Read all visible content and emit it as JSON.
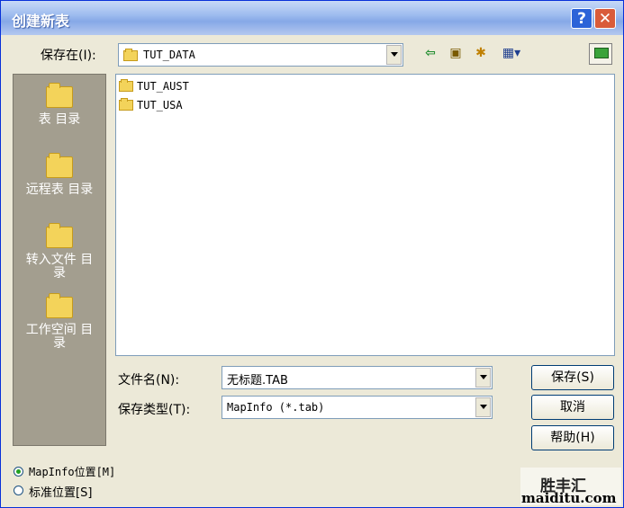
{
  "window": {
    "title": "创建新表"
  },
  "title_buttons": {
    "help": "?",
    "close": "✕"
  },
  "save_in": {
    "label": "保存在(I):",
    "value": "TUT_DATA"
  },
  "toolbar": [
    {
      "name": "back-arrow-icon",
      "glyph": "⇦"
    },
    {
      "name": "up-folder-icon",
      "glyph": "▣"
    },
    {
      "name": "new-folder-icon",
      "glyph": "✱"
    },
    {
      "name": "view-menu-icon",
      "glyph": "▦▾"
    }
  ],
  "places": [
    {
      "label": "表 目录"
    },
    {
      "label": "远程表 目录"
    },
    {
      "label": "转入文件 目录"
    },
    {
      "label": "工作空间 目录"
    }
  ],
  "files": [
    "TUT_AUST",
    "TUT_USA"
  ],
  "filename": {
    "label": "文件名(N):",
    "value": "无标题.TAB"
  },
  "filetype": {
    "label": "保存类型(T):",
    "value": "MapInfo (*.tab)"
  },
  "buttons": {
    "save": "保存(S)",
    "cancel": "取消",
    "help": "帮助(H)"
  },
  "location": {
    "mapinfo": "MapInfo位置[M]",
    "standard": "标准位置[S]",
    "selected": "mapinfo"
  },
  "watermark": {
    "line1": "胜丰汇",
    "line2": "maiditu.com"
  },
  "colors": {
    "title_bar": "#9fbdef",
    "dialog_bg": "#ece9d8",
    "places_bg": "#a39e8f",
    "folder": "#f3d35a",
    "close": "#d95b3a",
    "help": "#2c63d8"
  }
}
